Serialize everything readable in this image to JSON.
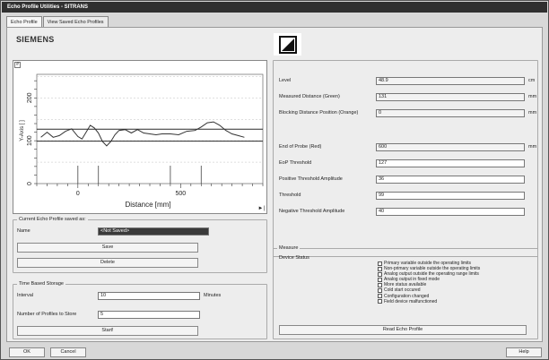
{
  "window": {
    "title": "Echo Profile Utilities - SITRANS"
  },
  "tabs": [
    {
      "label": "Echo Profile"
    },
    {
      "label": "View Saved Echo Profiles"
    }
  ],
  "brand": {
    "logo_text": "SIEMENS"
  },
  "chart_data": {
    "type": "line",
    "xlabel": "Distance [mm]",
    "ylabel": "Y-Axis [ ]",
    "xlim": [
      -200,
      900
    ],
    "ylim": [
      0,
      255
    ],
    "x_ticks": [
      "0",
      "500"
    ],
    "y_ticks": [
      "0",
      "100",
      "200"
    ],
    "series": [
      {
        "values": [
          [
            -180,
            108
          ],
          [
            -150,
            120
          ],
          [
            -120,
            108
          ],
          [
            -90,
            112
          ],
          [
            -60,
            122
          ],
          [
            -30,
            128
          ],
          [
            0,
            110
          ],
          [
            20,
            104
          ],
          [
            40,
            120
          ],
          [
            60,
            136
          ],
          [
            80,
            130
          ],
          [
            100,
            118
          ],
          [
            120,
            98
          ],
          [
            140,
            88
          ],
          [
            160,
            98
          ],
          [
            180,
            114
          ],
          [
            200,
            124
          ],
          [
            230,
            126
          ],
          [
            260,
            118
          ],
          [
            290,
            126
          ],
          [
            320,
            118
          ],
          [
            350,
            116
          ],
          [
            380,
            114
          ],
          [
            410,
            116
          ],
          [
            450,
            116
          ],
          [
            490,
            114
          ],
          [
            530,
            122
          ],
          [
            570,
            124
          ],
          [
            600,
            132
          ],
          [
            630,
            142
          ],
          [
            660,
            144
          ],
          [
            690,
            136
          ],
          [
            720,
            124
          ],
          [
            750,
            116
          ],
          [
            780,
            112
          ],
          [
            810,
            108
          ]
        ]
      }
    ],
    "thresholds": [
      127,
      99
    ],
    "markers": [
      0,
      100,
      450,
      600
    ],
    "colors": {
      "line": "#333333",
      "grid": "#bfbfbf"
    }
  },
  "current_echo": {
    "group_title": "Current Echo Profile saved as:",
    "name_label": "Name",
    "name_value": "<Not Saved>",
    "save_label": "Save",
    "delete_label": "Delete"
  },
  "storage": {
    "group_title": "Time Based Storage",
    "interval_label": "Interval",
    "interval_value": "10",
    "interval_unit": "Minutes",
    "profiles_label": "Number of Profiles to Store",
    "profiles_value": "5",
    "start_label": "Start!"
  },
  "readouts": [
    {
      "label": "Level",
      "value": "48.9",
      "unit": "cm"
    },
    {
      "label": "Measured Distance (Green)",
      "value": "131",
      "unit": "mm"
    },
    {
      "label": "Blocking Distance Position (Orange)",
      "value": "0",
      "unit": "mm"
    },
    {
      "label": "End of Probe (Red)",
      "value": "600",
      "unit": "mm"
    },
    {
      "label": "EoP Threshold",
      "value": "127",
      "unit": ""
    },
    {
      "label": "Positive Threshold Amplitude",
      "value": "36",
      "unit": ""
    },
    {
      "label": "Threshold",
      "value": "99",
      "unit": ""
    },
    {
      "label": "Negative Threshold Amplitude",
      "value": "40",
      "unit": ""
    }
  ],
  "measure": {
    "group_title": "Measure",
    "device_status_label": "Device Status",
    "status_items": [
      "Primary variable outside the operating limits",
      "Non-primary variable outside the operating limits",
      "Analog output outside the operating range limits",
      "Analog output in fixed mode",
      "More status available",
      "Cold start occured",
      "Configuration changed",
      "Field device malfunctioned"
    ],
    "read_label": "Read Echo Profile"
  },
  "footer": {
    "ok_label": "OK",
    "cancel_label": "Cancel",
    "help_label": "Help"
  }
}
